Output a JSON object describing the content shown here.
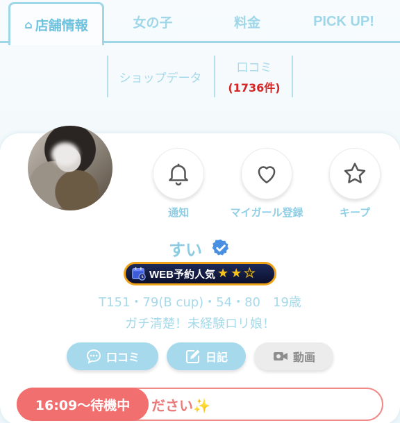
{
  "tabs": [
    {
      "label": "店舗情報",
      "active": true
    },
    {
      "label": "女の子",
      "active": false
    },
    {
      "label": "料金",
      "active": false
    },
    {
      "label": "PICK UP!",
      "active": false
    }
  ],
  "subtabs": {
    "shop_data": "ショップデータ",
    "reviews_label": "口コミ",
    "reviews_count": "(1736件)"
  },
  "profile": {
    "name": "すい",
    "verified": true,
    "badge_text": "WEB予約人気",
    "badge_stars_filled": 2,
    "badge_stars_total": 3,
    "stats": "T151・79(B cup)・54・80　19歳",
    "catchphrase": "ガチ清楚！未経験ロリ娘！"
  },
  "actions": {
    "notify": "通知",
    "favorite": "マイガール登録",
    "keep": "キープ"
  },
  "pills": {
    "reviews": "口コミ",
    "diary": "日記",
    "video": "動画"
  },
  "status": {
    "waiting": "16:09〜待機中",
    "message_tail": "ださい✨"
  },
  "colors": {
    "accent": "#9fd6e8",
    "pill": "#a7d9ec",
    "status": "#f26f6f",
    "review_count": "#d42626"
  }
}
